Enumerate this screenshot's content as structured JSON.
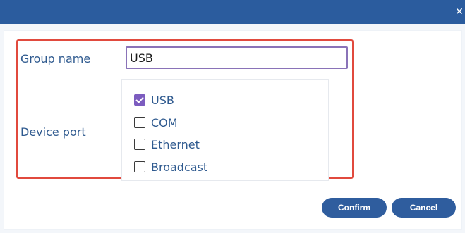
{
  "window": {
    "close_icon": "✕"
  },
  "form": {
    "group_name_label": "Group name",
    "group_name_value": "USB",
    "device_port_label": "Device port"
  },
  "ports": [
    {
      "label": "USB",
      "checked": true
    },
    {
      "label": "COM",
      "checked": false
    },
    {
      "label": "Ethernet",
      "checked": false
    },
    {
      "label": "Broadcast",
      "checked": false
    }
  ],
  "buttons": {
    "confirm_label": "Confirm",
    "cancel_label": "Cancel"
  },
  "colors": {
    "title_bar": "#2b5c9e",
    "accent_checkbox": "#7c5cbf",
    "highlight_border": "#e14a3e",
    "label_text": "#2f5a8f",
    "button": "#2f5d9e"
  },
  "icons": {
    "close": "close-icon",
    "checked": "check-icon"
  }
}
